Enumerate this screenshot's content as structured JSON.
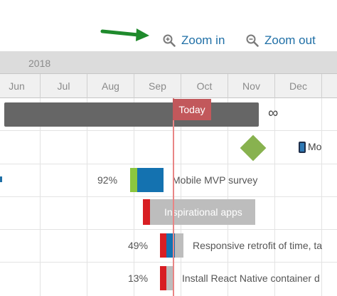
{
  "toolbar": {
    "zoom_in": {
      "icon": "zoom-in-icon",
      "label": "Zoom in"
    },
    "zoom_out": {
      "icon": "zoom-out-icon",
      "label": "Zoom out"
    },
    "pointer": "green-arrow"
  },
  "timeline": {
    "year": "2018",
    "months": [
      "Jun",
      "Jul",
      "Aug",
      "Sep",
      "Oct",
      "Nov",
      "Dec"
    ],
    "today_label": "Today"
  },
  "rows": {
    "summary": {
      "end_symbol": "∞"
    },
    "milestone": {
      "label": "Mo",
      "icon": "mobile-phone-icon",
      "color": "#88b24f"
    },
    "tasks": [
      {
        "pct": "92%",
        "label": "Mobile MVP survey"
      },
      {
        "pct": "",
        "label": "Inspirational apps"
      },
      {
        "pct": "49%",
        "label": "Responsive retrofit of time, ta"
      },
      {
        "pct": "13%",
        "label": "Install React Native container d"
      }
    ]
  },
  "colors": {
    "accent": "#1f6fa6",
    "today": "#c2585b",
    "progress_green": "#8cc63f",
    "progress_blue": "#1472b0",
    "critical_red": "#d81e23",
    "bar_gray": "#bdbdbd"
  }
}
